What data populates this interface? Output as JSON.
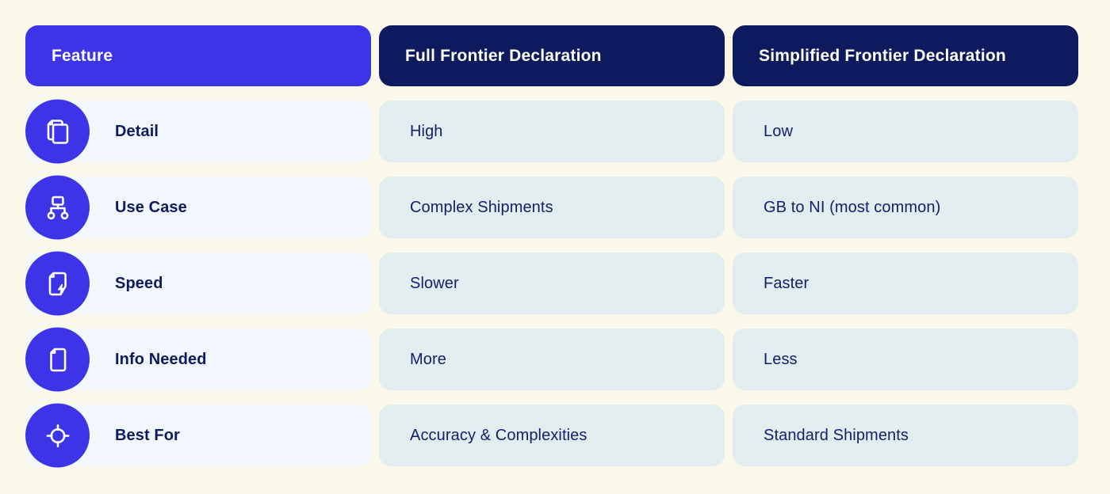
{
  "colors": {
    "page_background": "#f9f8ea",
    "feature_header": "#3d34e8",
    "column_header": "#0d1a5e",
    "feature_cell": "#f2f7fe",
    "data_cell": "#e1edee",
    "icon_circle": "#3d34e8",
    "heading_text": "#ffffff",
    "feature_text": "#0d1a5e",
    "data_text": "#15206b"
  },
  "header": {
    "feature_label": "Feature",
    "columns": [
      {
        "label": "Full Frontier Declaration"
      },
      {
        "label": "Simplified Frontier Declaration"
      }
    ]
  },
  "rows": [
    {
      "icon": "documents-copy-icon",
      "feature": "Detail",
      "full": "High",
      "simplified": "Low"
    },
    {
      "icon": "hierarchy-sitemap-icon",
      "feature": "Use Case",
      "full": "Complex Shipments",
      "simplified": "GB to NI (most common)"
    },
    {
      "icon": "document-lightning-icon",
      "feature": "Speed",
      "full": "Slower",
      "simplified": "Faster"
    },
    {
      "icon": "document-file-icon",
      "feature": "Info Needed",
      "full": "More",
      "simplified": "Less"
    },
    {
      "icon": "crosshair-target-icon",
      "feature": "Best For",
      "full": "Accuracy & Complexities",
      "simplified": "Standard Shipments"
    }
  ]
}
